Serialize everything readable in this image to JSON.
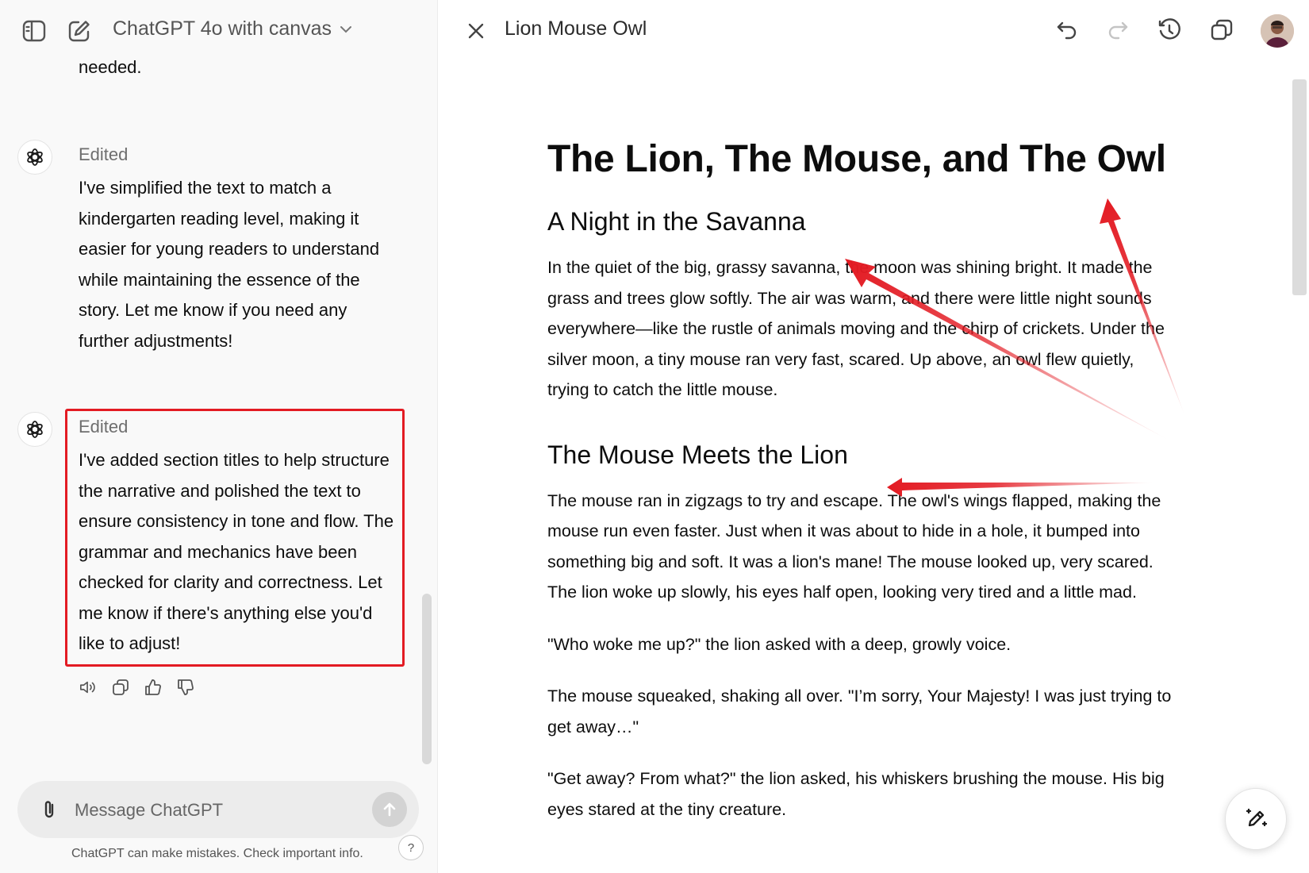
{
  "chat": {
    "model_title": "ChatGPT 4o with canvas",
    "prev_tail": "needed.",
    "messages": [
      {
        "status": "Edited",
        "lines": [
          "I've simplified the text to match a",
          "kindergarten reading level, making it",
          "easier for young readers to understand",
          "while maintaining the essence of the",
          "story. Let me know if you need any",
          "further adjustments!"
        ]
      },
      {
        "status": "Edited",
        "lines": [
          "I've added section titles to help structure",
          "the narrative and polished the text to",
          "ensure consistency in tone and flow. The",
          "grammar and mechanics have been",
          "checked for clarity and correctness. Let",
          "me know if there's anything else you'd",
          "like to adjust!"
        ]
      }
    ],
    "composer_placeholder": "Message ChatGPT",
    "disclaimer": "ChatGPT can make mistakes. Check important info.",
    "help_label": "?"
  },
  "canvas": {
    "doc_title": "Lion Mouse Owl",
    "heading": "The Lion, The Mouse, and The Owl",
    "sections": [
      {
        "title": "A Night in the Savanna",
        "paragraphs": [
          [
            "In the quiet of the big, grassy savanna, the moon was shining bright. It made the",
            "grass and trees glow softly. The air was warm, and there were little night sounds",
            "everywhere—like the rustle of animals moving and the chirp of crickets. Under the",
            "silver moon, a tiny mouse ran very fast, scared. Up above, an owl flew quietly,",
            "trying to catch the little mouse."
          ]
        ]
      },
      {
        "title": "The Mouse Meets the Lion",
        "paragraphs": [
          [
            "The mouse ran in zigzags to try and escape. The owl's wings flapped, making the",
            "mouse run even faster. Just when it was about to hide in a hole, it bumped into",
            "something big and soft. It was a lion's mane! The mouse looked up, very scared.",
            "The lion woke up slowly, his eyes half open, looking very tired and a little mad."
          ],
          [
            "\"Who woke me up?\" the lion asked with a deep, growly voice."
          ],
          [
            "The mouse squeaked, shaking all over. \"I’m sorry, Your Majesty! I was just trying to",
            "get away…\""
          ],
          [
            "\"Get away? From what?\" the lion asked, his whiskers brushing the mouse. His big",
            "eyes stared at the tiny creature."
          ]
        ]
      }
    ]
  },
  "icons": {
    "sidebar_toggle": "sidebar-toggle-icon",
    "new_chat": "compose-icon",
    "model_dropdown": "chevron-down-icon",
    "close": "close-icon",
    "undo": "undo-icon",
    "redo": "redo-icon",
    "history": "history-icon",
    "copy": "copy-icon",
    "read_aloud": "speaker-icon",
    "thumbs_up": "thumbs-up-icon",
    "thumbs_down": "thumbs-down-icon",
    "attach": "paperclip-icon",
    "send": "arrow-up-icon",
    "suggest_edits": "pencil-sparkle-icon",
    "chatgpt_logo": "openai-logo-icon"
  },
  "colors": {
    "annotation_red": "#e31b23",
    "chat_bg": "#f9f9f9",
    "composer_bg": "#ececec"
  }
}
